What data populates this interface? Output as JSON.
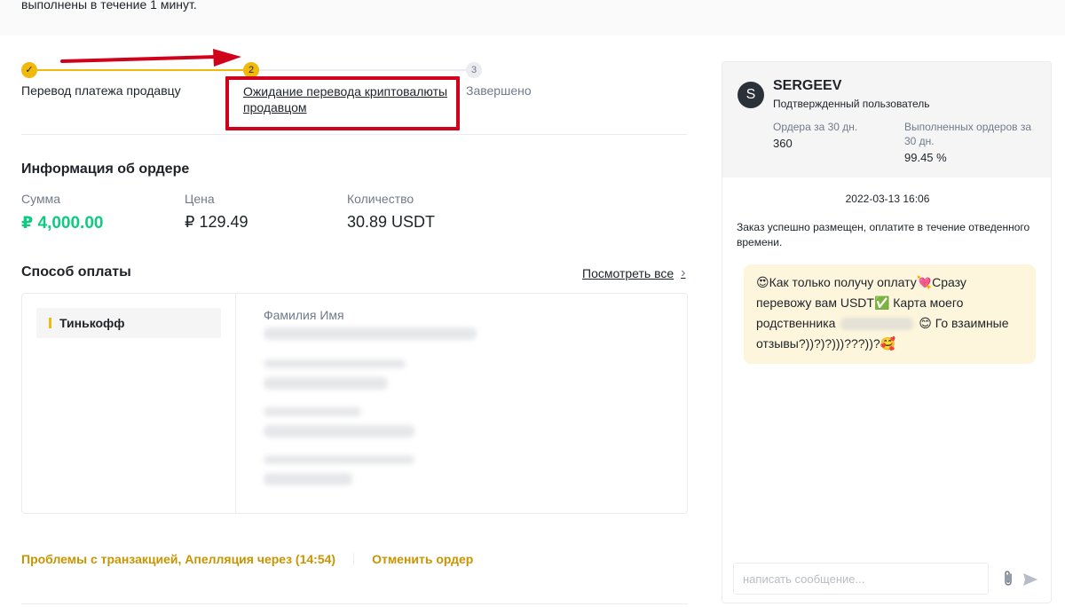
{
  "banner": {
    "text": "выполнены в течение 1 минут."
  },
  "stepper": {
    "steps": [
      {
        "number": "✓",
        "label": "Перевод платежа продавцу"
      },
      {
        "number": "2",
        "label": "Ожидание перевода криптовалюты продавцом"
      },
      {
        "number": "3",
        "label": "Завершено"
      }
    ]
  },
  "order_info": {
    "title": "Информация об ордере",
    "amount_label": "Сумма",
    "amount_value": "₽ 4,000.00",
    "price_label": "Цена",
    "price_value": "₽ 129.49",
    "quantity_label": "Количество",
    "quantity_value": "30.89 USDT"
  },
  "payment": {
    "title": "Способ оплаты",
    "see_all": "Посмотреть все",
    "bank": "Тинькофф",
    "field_label": "Фамилия Имя"
  },
  "footer": {
    "appeal": "Проблемы с транзакцией, Апелляция через (14:54)",
    "cancel": "Отменить ордер"
  },
  "chat": {
    "avatar_letter": "S",
    "username": "SERGEEV",
    "verified": "Подтвержденный пользователь",
    "orders_label": "Ордера за 30 дн.",
    "orders_value": "360",
    "completed_label": "Выполненных ордеров за 30 дн.",
    "completed_value": "99.45 %",
    "date": "2022-03-13 16:06",
    "system_message": "Заказ успешно размещен, оплатите в течение отведенного времени.",
    "bubble_part1": "😍Как только получу оплату💘Сразу перевожу вам USDT✅ Карта моего родственника",
    "bubble_part2": "😊 Го взаимные отзывы?))?)?)))???))?🥰",
    "input_placeholder": "написать сообщение..."
  },
  "colors": {
    "accent": "#f0b90b",
    "green": "#0ecb81",
    "link": "#c99400",
    "annotation_red": "#d0021b"
  }
}
